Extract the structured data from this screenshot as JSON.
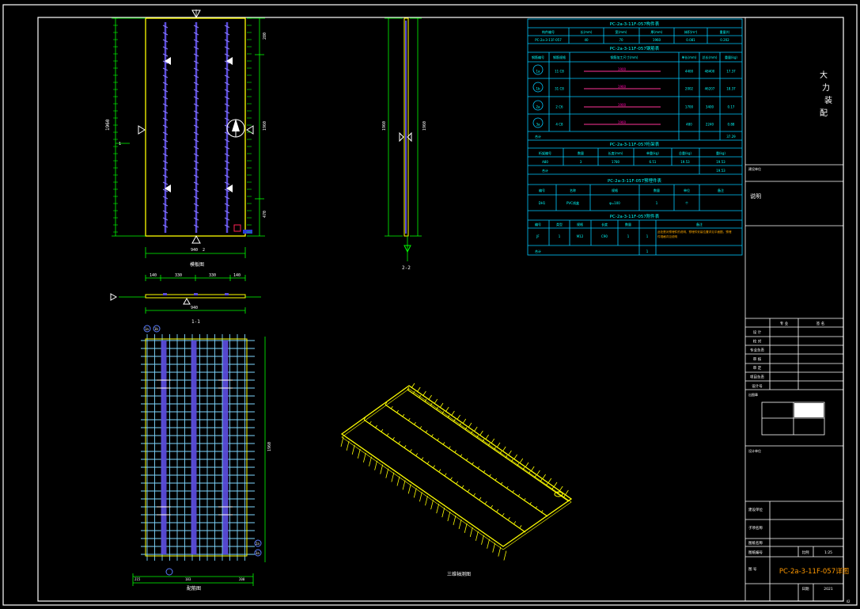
{
  "drawing_title": "PC-2a-3-11F-057详图",
  "title_block": {
    "chars": [
      "大",
      "力",
      "装",
      "配"
    ],
    "project_label": "建设单位",
    "notes_box_label": "说明",
    "sign_label": "出图章",
    "scale_key": "比例",
    "scale_val": "1:25",
    "date_key": "日期",
    "date_val": "2021",
    "page": "42",
    "rows": [
      "设 计",
      "校 对",
      "专业负责",
      "审 核",
      "审 定",
      "项目负责",
      "设计号"
    ],
    "cols": [
      "专 业",
      "签 名"
    ],
    "labels_bottom": [
      "设计单位",
      "建设单位",
      "子项名称",
      "图纸名称",
      "图纸编号",
      "图 号"
    ]
  },
  "schedule": {
    "t1_title": "PC-2a-3-11F-057构件表",
    "t1_head": [
      "构件编号",
      "长(mm)",
      "宽(mm)",
      "厚(mm)",
      "体积(m³)",
      "重量(t)"
    ],
    "t1_row": [
      "PC-2a-3-11F-057",
      "40",
      "70",
      "1960",
      "0.081",
      "0.202"
    ],
    "t2_title": "PC-2a-3-11F-057钢筋表",
    "t2_head": [
      "钢筋编号",
      "钢筋规格",
      "钢筋加工尺寸(mm)",
      "单长(mm)",
      "总长(mm)",
      "重量(kg)"
    ],
    "t2_rows": [
      {
        "id": "1a",
        "spec": "11 C8",
        "dim": "1900",
        "len": "4400",
        "tot": "48400",
        "wt": "17.37"
      },
      {
        "id": "1b",
        "spec": "31 C8",
        "dim": "1960",
        "len": "2002",
        "tot": "46207",
        "wt": "18.37"
      },
      {
        "id": "2a",
        "spec": "2 C6",
        "dim": "1900",
        "len": "1700",
        "tot": "3400",
        "wt": "0.17"
      },
      {
        "id": "3a",
        "spec": "4 C8",
        "dim": "1960",
        "len": "480",
        "tot": "2240",
        "wt": "0.88"
      }
    ],
    "t2_total_label": "合计",
    "t2_total": "37.29",
    "t3_title": "PC-2a-3-11F-057桁架表",
    "t3_head": [
      "桁架编号",
      "数量",
      "长度(mm)",
      "单重(kg)",
      "总重(kg)",
      "重(kg)"
    ],
    "t3_rows": [
      [
        "A80",
        "3",
        "1780",
        "6.51",
        "19.53",
        "19.53"
      ],
      [
        "合计",
        "",
        "",
        "",
        "",
        "19.53"
      ]
    ],
    "t4_title": "PC-2a-3-11F-057预埋件表",
    "t4_head": [
      "编号",
      "名称",
      "规格",
      "数量",
      "单位",
      "备注"
    ],
    "t4_row": [
      "DH1",
      "PVC线盒",
      "φ=100",
      "1",
      "个",
      ""
    ],
    "t5_title": "PC-2a-3-11F-057附件表",
    "t5_head": [
      "编号",
      "类型",
      "规格",
      "长度",
      "数量",
      "备注"
    ],
    "t5_row": [
      "JF",
      "1",
      "M12",
      "C90",
      "1",
      "1"
    ],
    "t5_note": "此处是对预埋件的说明，预埋件安装位置详见平面图，预埋件规格详见说明",
    "t5_total_label": "合计",
    "t5_total": "1"
  },
  "views": {
    "plan_label": "模板图",
    "section11_label": "1-1",
    "section22_label": "2-2",
    "rebar_label": "配筋图",
    "iso_label": "三维轴测图",
    "dim_width": "940",
    "dim_segments": [
      "140",
      "330",
      "330",
      "140"
    ],
    "dim_height": "1960",
    "dim_side": [
      "280",
      "1960",
      "470"
    ],
    "rebar_marks": [
      "1a",
      "1b",
      "2a",
      "3a"
    ],
    "dims_rebar_bottom": [
      "215",
      "183",
      "182",
      "200"
    ],
    "sec_labels": [
      "1",
      "1",
      "2",
      "2"
    ]
  },
  "colors": {
    "background": "#000000",
    "frame": "#ffffff",
    "dim": "#00ff00",
    "slab": "#ffff00",
    "rebar": "#5a4bd8",
    "rebar_grid": "#7fd8ff",
    "table": "#00c8ff",
    "table_text": "#00ffff",
    "title_red": "#ff00aa",
    "annot": "#ffaa00"
  }
}
